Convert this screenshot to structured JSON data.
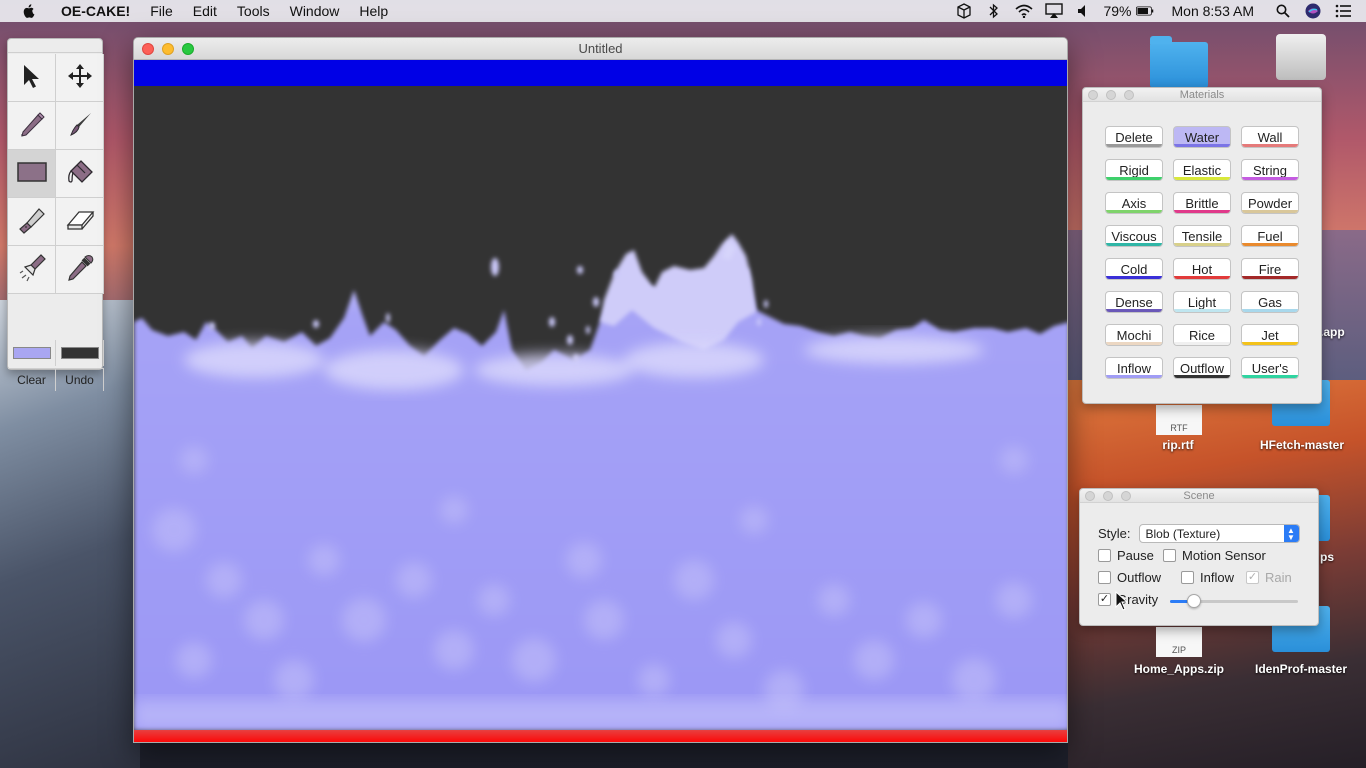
{
  "menubar": {
    "app_name": "OE-CAKE!",
    "menus": [
      "File",
      "Edit",
      "Tools",
      "Window",
      "Help"
    ],
    "battery": "79%",
    "clock": "Mon 8:53 AM"
  },
  "tools": {
    "items": [
      "arrow-select",
      "move",
      "pencil",
      "brush",
      "rectangle",
      "paint-bucket",
      "knife",
      "eraser",
      "flashlight",
      "dropper"
    ],
    "active": "rectangle",
    "fg_color": "#a9a6f2",
    "bg_color": "#333333",
    "clear_label": "Clear",
    "undo_label": "Undo"
  },
  "window": {
    "title": "Untitled",
    "canvas_bg": "#333333",
    "water_color": "#a09cf5",
    "top_wall_color": "#0000e6",
    "bottom_wall_color": "#ff0000"
  },
  "materials": {
    "title": "Materials",
    "selected": "Water",
    "buttons": [
      {
        "label": "Delete",
        "color": "#9a9a9a"
      },
      {
        "label": "Water",
        "color": "#7b74e6"
      },
      {
        "label": "Wall",
        "color": "#e57a7a"
      },
      {
        "label": "Rigid",
        "color": "#3ed06b"
      },
      {
        "label": "Elastic",
        "color": "#d8e83a"
      },
      {
        "label": "String",
        "color": "#c45be0"
      },
      {
        "label": "Axis",
        "color": "#7fd36b"
      },
      {
        "label": "Brittle",
        "color": "#e0398a"
      },
      {
        "label": "Powder",
        "color": "#d9c79a"
      },
      {
        "label": "Viscous",
        "color": "#2fb6a6"
      },
      {
        "label": "Tensile",
        "color": "#d8d08a"
      },
      {
        "label": "Fuel",
        "color": "#e98a2e"
      },
      {
        "label": "Cold",
        "color": "#3a2fd8"
      },
      {
        "label": "Hot",
        "color": "#e23a3a"
      },
      {
        "label": "Fire",
        "color": "#a32828"
      },
      {
        "label": "Dense",
        "color": "#6a58b8"
      },
      {
        "label": "Light",
        "color": "#bfe6f0"
      },
      {
        "label": "Gas",
        "color": "#a8d8ec"
      },
      {
        "label": "Mochi",
        "color": "#ecd7c2"
      },
      {
        "label": "Rice",
        "color": "#f0f0f0"
      },
      {
        "label": "Jet",
        "color": "#f3c21a"
      },
      {
        "label": "Inflow",
        "color": "#a09cf5"
      },
      {
        "label": "Outflow",
        "color": "#333333"
      },
      {
        "label": "User's",
        "color": "#2fd4a0"
      }
    ]
  },
  "scene": {
    "title": "Scene",
    "style_label": "Style:",
    "style_value": "Blob (Texture)",
    "pause_label": "Pause",
    "pause_checked": false,
    "motion_label": "Motion Sensor",
    "motion_checked": false,
    "outflow_label": "Outflow",
    "outflow_checked": false,
    "inflow_label": "Inflow",
    "inflow_checked": false,
    "rain_label": "Rain",
    "rain_checked": true,
    "gravity_label": "Gravity",
    "gravity_checked": true,
    "gravity_level": 0.19
  },
  "desktop": {
    "icons": [
      {
        "label": "rip.rtf",
        "badge": "RTF"
      },
      {
        "label": "HFetch-master",
        "badge": ""
      },
      {
        "label": "Home_Apps.zip",
        "badge": "ZIP"
      },
      {
        "label": "IdenProf-master",
        "badge": ""
      },
      {
        "label": ".app",
        "badge": ""
      },
      {
        "label": "ps",
        "badge": ""
      }
    ]
  }
}
